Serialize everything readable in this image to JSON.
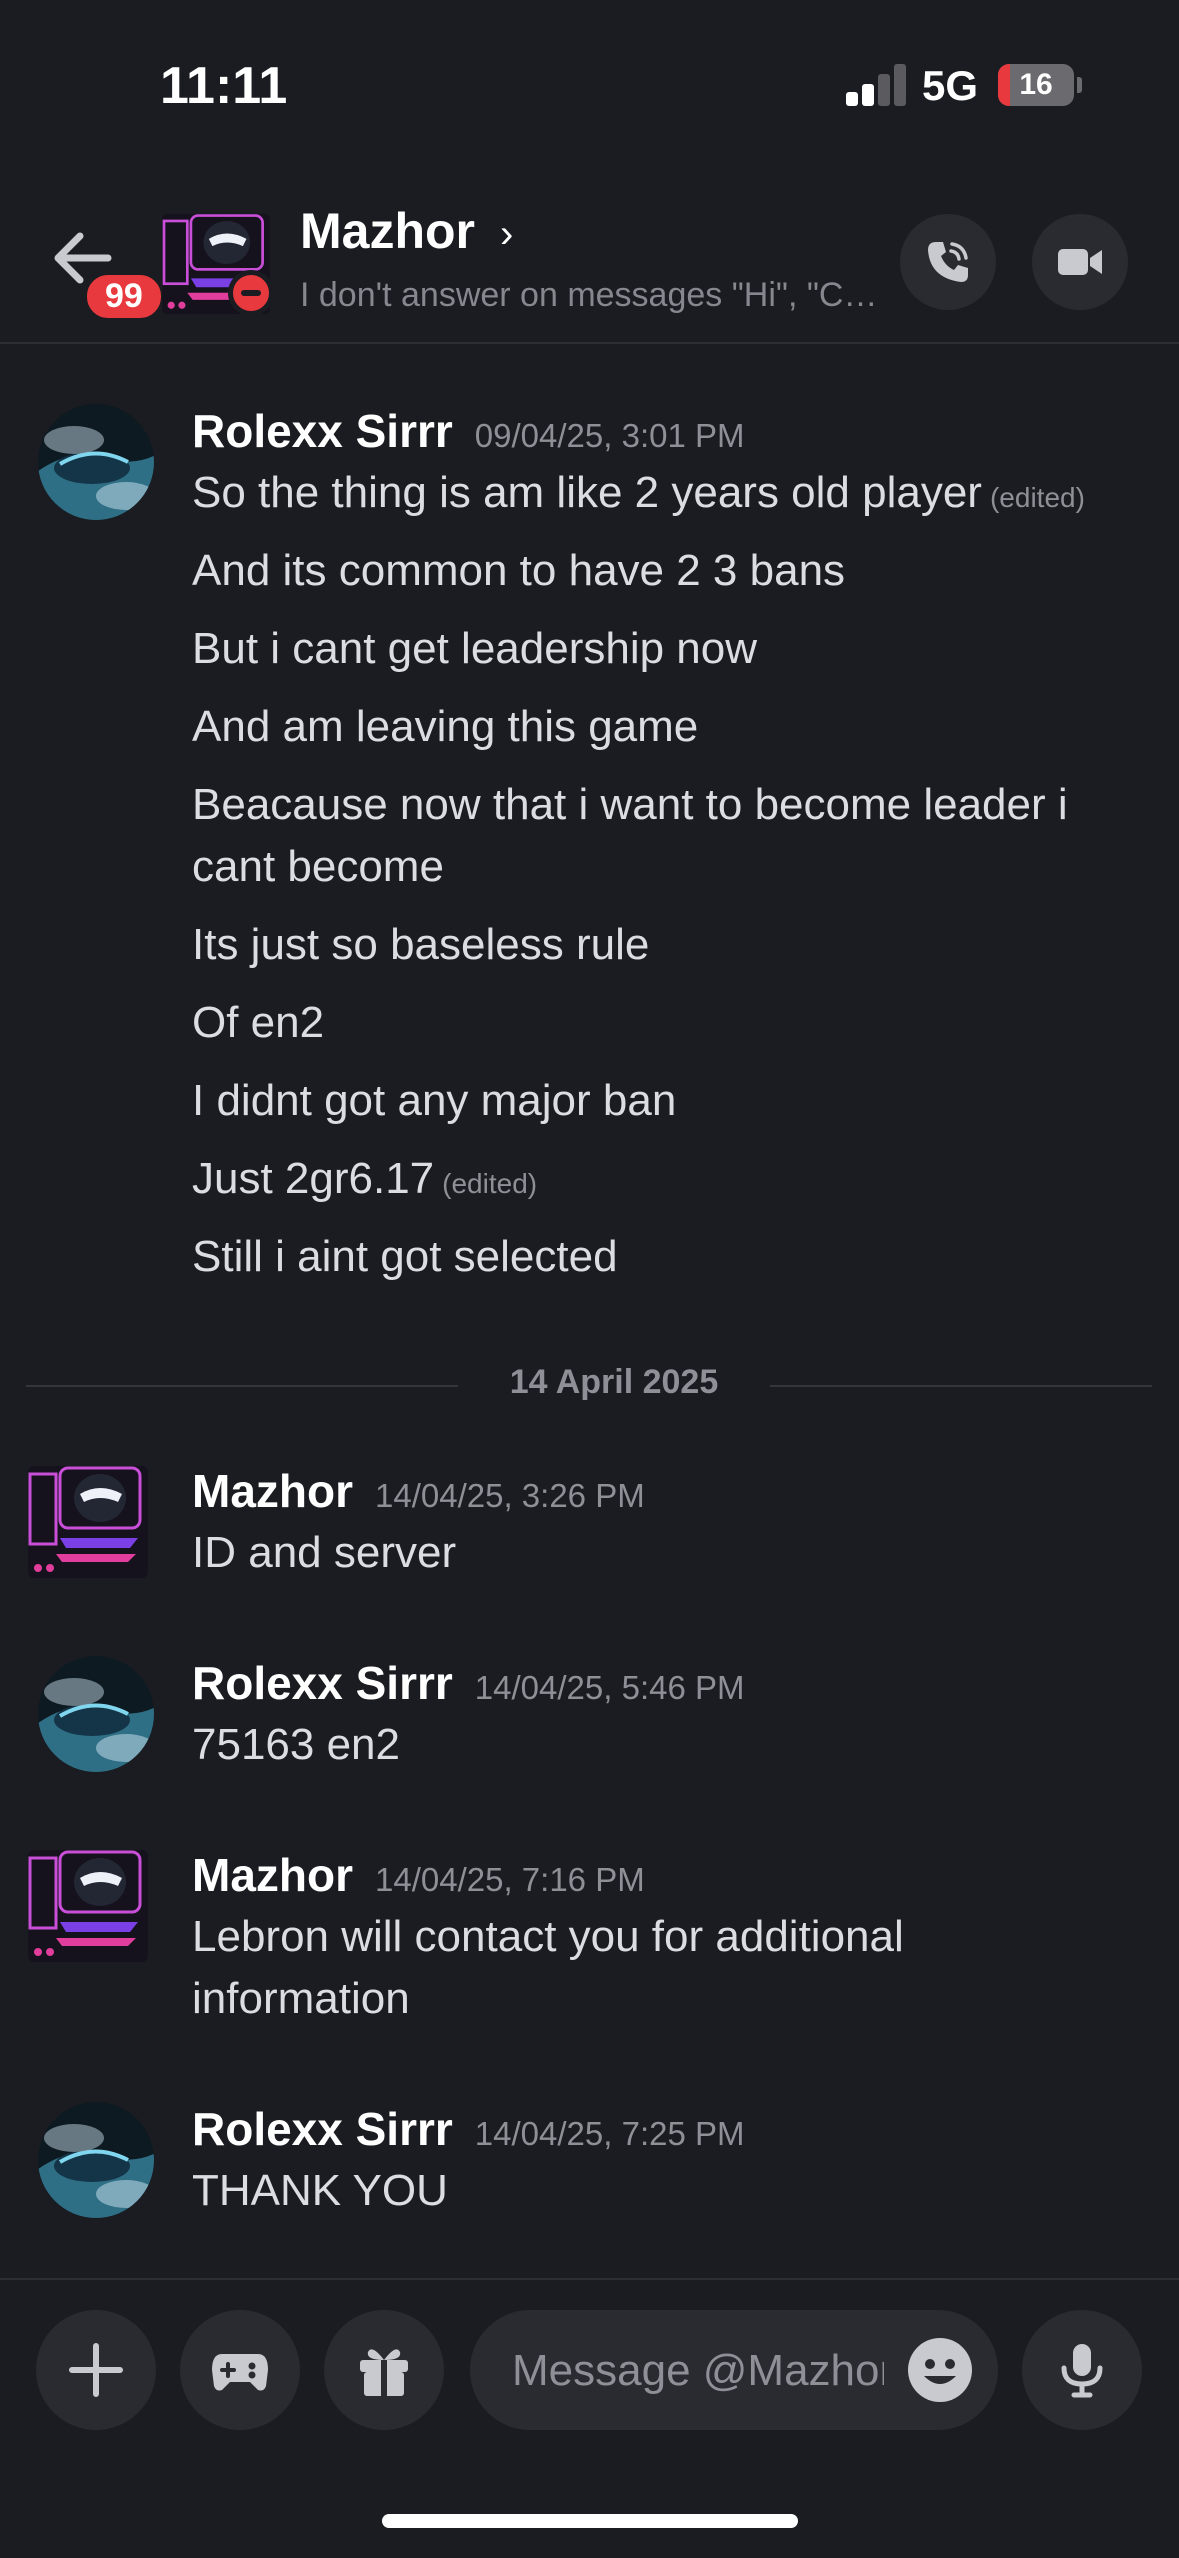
{
  "status_bar": {
    "time": "11:11",
    "network": "5G",
    "battery_level": "16",
    "battery_fraction": 0.16,
    "signal_bars_active": 2,
    "signal_bars_total": 4
  },
  "header": {
    "unread_count": "99",
    "title": "Mazhor",
    "chevron": "›",
    "custom_status": "I don't answer on messages \"Hi\", \"Ca...",
    "status_indicator": "do-not-disturb",
    "call_icon": "phone-icon",
    "video_icon": "video-icon"
  },
  "messages": [
    {
      "author": "Rolexx Sirrr",
      "timestamp": "09/04/25, 3:01 PM",
      "lines": [
        {
          "text": "So the thing is am like 2 years old player",
          "edited": "(edited)"
        },
        {
          "text": "And its common to have 2 3 bans"
        },
        {
          "text": "But i cant get leadership now"
        },
        {
          "text": "And am leaving this game"
        },
        {
          "text": "Beacause now that i want to become leader i cant become"
        },
        {
          "text": "Its just so baseless rule"
        },
        {
          "text": "Of en2"
        },
        {
          "text": "I didnt got any major ban"
        },
        {
          "text": "Just 2gr6.17",
          "edited": "(edited)"
        },
        {
          "text": "Still i aint got selected"
        }
      ]
    },
    {
      "author": "Mazhor",
      "timestamp": "14/04/25, 3:26 PM",
      "lines": [
        {
          "text": "ID and server"
        }
      ]
    },
    {
      "author": "Rolexx Sirrr",
      "timestamp": "14/04/25, 5:46 PM",
      "lines": [
        {
          "text": "75163 en2"
        }
      ]
    },
    {
      "author": "Mazhor",
      "timestamp": "14/04/25, 7:16 PM",
      "lines": [
        {
          "text": "Lebron will contact you for additional information"
        }
      ]
    },
    {
      "author": "Rolexx Sirrr",
      "timestamp": "14/04/25, 7:25 PM",
      "lines": [
        {
          "text": "THANK YOU"
        }
      ]
    }
  ],
  "date_divider": "14 April 2025",
  "composer": {
    "placeholder": "Message @Mazhor",
    "buttons": [
      "plus-icon",
      "gamepad-icon",
      "gift-icon",
      "emoji-icon",
      "microphone-icon"
    ]
  },
  "colors": {
    "background": "#1b1c21",
    "surface": "#2a2b31",
    "text": "#dcdde2",
    "muted": "#8e8f97",
    "badge_red": "#e8393e"
  }
}
